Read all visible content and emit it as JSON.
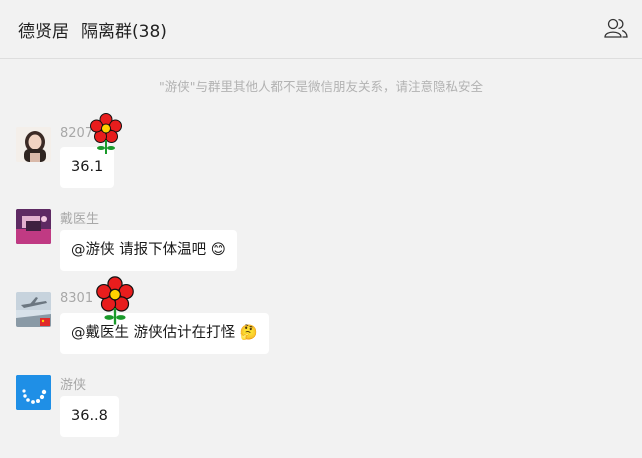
{
  "header": {
    "title": "德贤居",
    "group_name": "隔离群(38)"
  },
  "notice": "\"游侠\"与群里其他人都不是微信朋友关系，请注意隐私安全",
  "messages": [
    {
      "name": "8207",
      "text": "36.1"
    },
    {
      "name": "戴医生",
      "text": "@游侠 请报下体温吧",
      "emoji": "😊"
    },
    {
      "name": "8301",
      "text": "@戴医生 游侠估计在打怪",
      "emoji": "🤔"
    },
    {
      "name": "游侠",
      "text": "36..8"
    }
  ],
  "icons": {
    "header_right": "people-icon",
    "sticker": "red-flower-icon"
  },
  "colors": {
    "background": "#f2f2f2",
    "bubble": "#ffffff",
    "name_text": "#a8a8a8",
    "notice_text": "#b2b2b2",
    "flower_petal": "#e81d1d",
    "flower_center": "#ffd200",
    "stem": "#1a9a2a"
  }
}
